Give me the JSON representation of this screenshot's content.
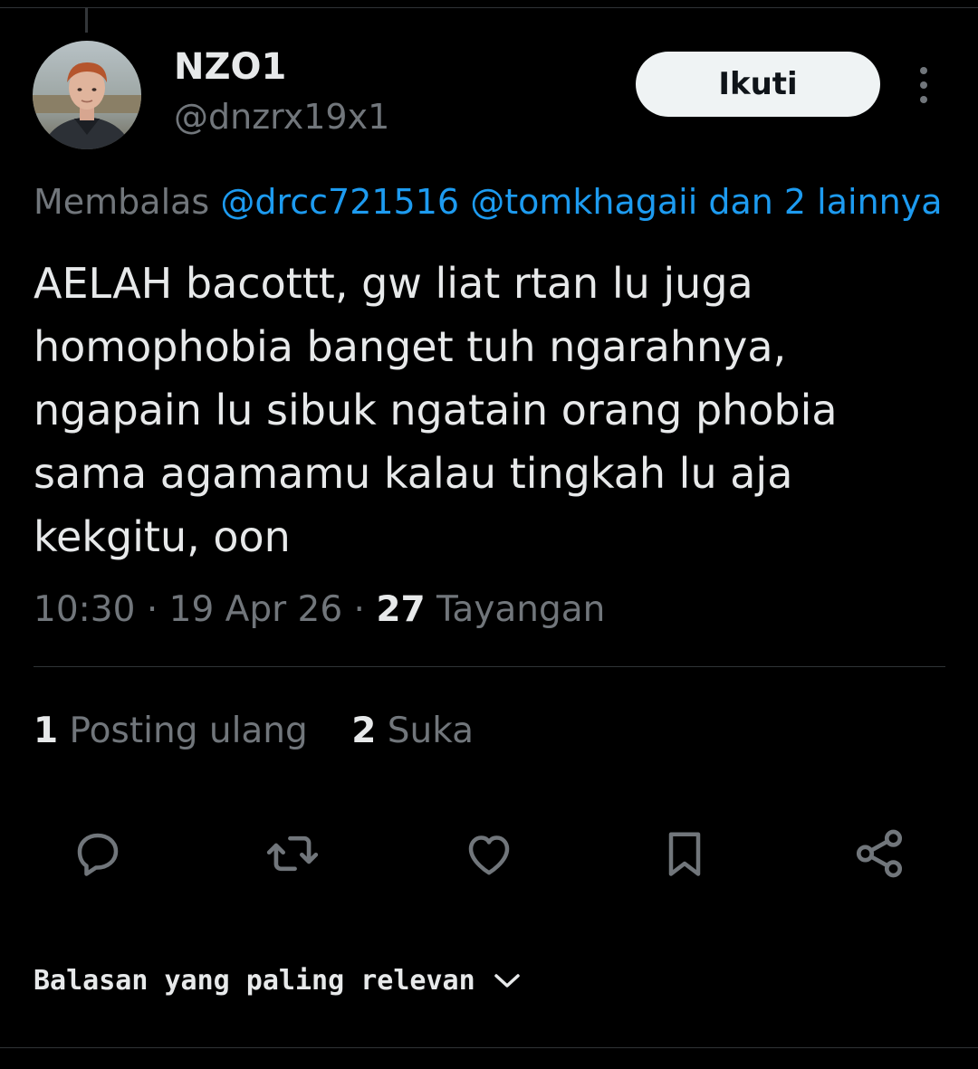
{
  "user": {
    "display_name": "NZO1",
    "handle": "@dnzrx19x1",
    "avatar_icon": "profile-photo"
  },
  "header": {
    "follow_label": "Ikuti",
    "more_icon": "vertical-ellipsis-icon"
  },
  "reply_to": {
    "prefix": "Membalas",
    "mention_1": "@drcc721516",
    "mention_2": "@tomkhagaii",
    "others": "dan 2 lainnya"
  },
  "tweet": {
    "text": "AELAH bacottt, gw liat rtan lu juga homophobia banget tuh ngarahnya, ngapain lu sibuk ngatain orang phobia sama agamamu kalau tingkah lu aja kekgitu, oon",
    "time": "10:30",
    "date": "19 Apr 26",
    "separator": "·",
    "views_count": "27",
    "views_label": "Tayangan"
  },
  "stats": {
    "reposts_count": "1",
    "reposts_label": "Posting ulang",
    "likes_count": "2",
    "likes_label": "Suka"
  },
  "actions": [
    {
      "name": "reply",
      "icon": "reply-icon"
    },
    {
      "name": "repost",
      "icon": "repost-icon"
    },
    {
      "name": "like",
      "icon": "heart-icon"
    },
    {
      "name": "bookmark",
      "icon": "bookmark-icon"
    },
    {
      "name": "share",
      "icon": "share-icon"
    }
  ],
  "sort": {
    "label": "Balasan yang paling relevan",
    "icon": "chevron-down-icon"
  },
  "colors": {
    "background": "#000000",
    "text_primary": "#e7e9ea",
    "text_secondary": "#71767b",
    "link": "#1d9bf0",
    "divider": "#2f3336",
    "follow_button_bg": "#eff3f4"
  }
}
